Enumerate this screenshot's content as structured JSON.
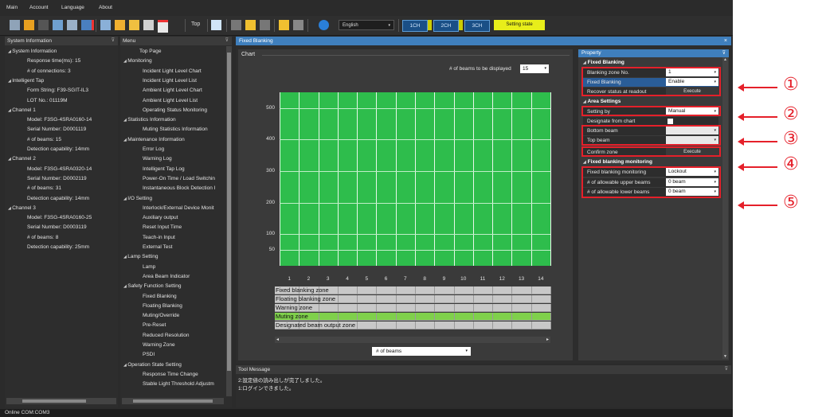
{
  "menubar": {
    "items": [
      "Main",
      "Account",
      "Language",
      "About"
    ]
  },
  "toolbar": {
    "top_label": "Top",
    "language": "English",
    "channels": [
      "1CH",
      "2CH",
      "3CH"
    ],
    "setting_state": "Setting state"
  },
  "system_information": {
    "title": "System Information",
    "rows": [
      {
        "text": "System Information",
        "level": 0,
        "expander": true
      },
      {
        "text": "Response time(ms): 15",
        "level": 2
      },
      {
        "text": "# of connections: 3",
        "level": 2
      },
      {
        "text": "Intelligent Tap",
        "level": 0,
        "expander": true
      },
      {
        "text": "Form String: F39-SGIT-IL3",
        "level": 2
      },
      {
        "text": "LOT No.: 01119M",
        "level": 2
      },
      {
        "text": "Channel 1",
        "level": 0,
        "expander": true
      },
      {
        "text": "Model: F3SG-4SRA0160-14",
        "level": 2
      },
      {
        "text": "Serial Number: D0001119",
        "level": 2
      },
      {
        "text": "# of beams: 15",
        "level": 2
      },
      {
        "text": "Detection capability: 14mm",
        "level": 2
      },
      {
        "text": "Channel 2",
        "level": 0,
        "expander": true
      },
      {
        "text": "Model: F3SG-4SRA0320-14",
        "level": 2
      },
      {
        "text": "Serial Number: D0002119",
        "level": 2
      },
      {
        "text": "# of beams: 31",
        "level": 2
      },
      {
        "text": "Detection capability: 14mm",
        "level": 2
      },
      {
        "text": "Channel 3",
        "level": 0,
        "expander": true
      },
      {
        "text": "Model: F3SG-4SRA0160-25",
        "level": 2
      },
      {
        "text": "Serial Number: D0003119",
        "level": 2
      },
      {
        "text": "# of beams: 8",
        "level": 2
      },
      {
        "text": "Detection capability: 25mm",
        "level": 2
      }
    ]
  },
  "menu": {
    "title": "Menu",
    "rows": [
      {
        "text": "Top Page",
        "level": 1
      },
      {
        "text": "Monitoring",
        "level": 0,
        "expander": true
      },
      {
        "text": "Incident Light Level Chart",
        "level": 2
      },
      {
        "text": "Incident Light Level List",
        "level": 2
      },
      {
        "text": "Ambient Light Level Chart",
        "level": 2
      },
      {
        "text": "Ambient Light Level List",
        "level": 2
      },
      {
        "text": "Operating Status Monitoring",
        "level": 2
      },
      {
        "text": "Statistics Information",
        "level": 0,
        "expander": true
      },
      {
        "text": "Muting Statistics Information",
        "level": 2
      },
      {
        "text": "Maintenance Information",
        "level": 0,
        "expander": true
      },
      {
        "text": "Error Log",
        "level": 2
      },
      {
        "text": "Warning Log",
        "level": 2
      },
      {
        "text": "Intelligent Tap Log",
        "level": 2
      },
      {
        "text": "Power-On Time / Load Switchin",
        "level": 2
      },
      {
        "text": "Instantaneous Block Detection I",
        "level": 2
      },
      {
        "text": "I/O Setting",
        "level": 0,
        "expander": true
      },
      {
        "text": "Interlock/External Device Monit",
        "level": 2
      },
      {
        "text": "Auxiliary output",
        "level": 2
      },
      {
        "text": "Reset Input Time",
        "level": 2
      },
      {
        "text": "Teach-in Input",
        "level": 2
      },
      {
        "text": "External Test",
        "level": 2
      },
      {
        "text": "Lamp Setting",
        "level": 0,
        "expander": true
      },
      {
        "text": "Lamp",
        "level": 2
      },
      {
        "text": "Area Beam Indicator",
        "level": 2
      },
      {
        "text": "Safety Function Setting",
        "level": 0,
        "expander": true
      },
      {
        "text": "Fixed Blanking",
        "level": 2
      },
      {
        "text": "Floating Blanking",
        "level": 2
      },
      {
        "text": "Muting/Override",
        "level": 2
      },
      {
        "text": "Pre-Reset",
        "level": 2
      },
      {
        "text": "Reduced Resolution",
        "level": 2
      },
      {
        "text": "Warning Zone",
        "level": 2
      },
      {
        "text": "PSDI",
        "level": 2
      },
      {
        "text": "Operation State Setting",
        "level": 0,
        "expander": true
      },
      {
        "text": "Response Time Change",
        "level": 2
      },
      {
        "text": "Stable Light Threshold Adjustm",
        "level": 2
      }
    ]
  },
  "fixed_blanking": {
    "title": "Fixed Blanking",
    "chart": {
      "title": "Chart",
      "beams_label": "# of beams to be displayed",
      "beams_value": "15",
      "bottom_select": "# of beams",
      "zones": [
        "Fixed blanking zone",
        "Floating blanking zone",
        "Warning zone",
        "Muting zone",
        "Designated beam output zone"
      ]
    }
  },
  "chart_data": {
    "type": "bar",
    "categories": [
      "1",
      "2",
      "3",
      "4",
      "5",
      "6",
      "7",
      "8",
      "9",
      "10",
      "11",
      "12",
      "13",
      "14"
    ],
    "yticks": [
      "500",
      "400",
      "300",
      "200",
      "100",
      "50"
    ],
    "ylim": [
      0,
      550
    ],
    "values": [
      550,
      550,
      550,
      550,
      550,
      550,
      550,
      550,
      550,
      550,
      550,
      550,
      550,
      550
    ],
    "bar_color": "#2ebd4c",
    "grid": true
  },
  "property": {
    "title": "Property",
    "sections": {
      "fixed_blanking": {
        "title": "Fixed Blanking",
        "blanking_zone_no_label": "Blanking zone No.",
        "blanking_zone_no_value": "1",
        "fixed_blanking_label": "Fixed Blanking",
        "fixed_blanking_value": "Enable",
        "recover_label": "Recover status at readout",
        "recover_button": "Execute"
      },
      "area_settings": {
        "title": "Area Settings",
        "setting_by_label": "Setting by",
        "setting_by_value": "Manual",
        "designate_label": "Designate from chart",
        "bottom_beam_label": "Bottom beam",
        "top_beam_label": "Top beam",
        "confirm_label": "Confirm zone",
        "confirm_button": "Execute"
      },
      "monitoring": {
        "title": "Fixed blanking monitoring",
        "monitoring_label": "Fixed blanking monitoring",
        "monitoring_value": "Lockout",
        "upper_label": "# of allowable upper beams",
        "upper_value": "0 beam",
        "lower_label": "# of allowable lower beams",
        "lower_value": "0 beam"
      }
    }
  },
  "annotations": [
    "①",
    "②",
    "③",
    "④",
    "⑤"
  ],
  "tool_message": {
    "title": "Tool Message",
    "lines": [
      "2:設定値の読み出しが完了しました。",
      "1:ログインできました。"
    ]
  },
  "status_bar": {
    "text": "Online    COM:COM3"
  },
  "colors": {
    "accent": "#3f7fbd",
    "chart_green": "#2ebd4c",
    "annotation_red": "#e5202a",
    "highlight": "#2a5d98"
  }
}
